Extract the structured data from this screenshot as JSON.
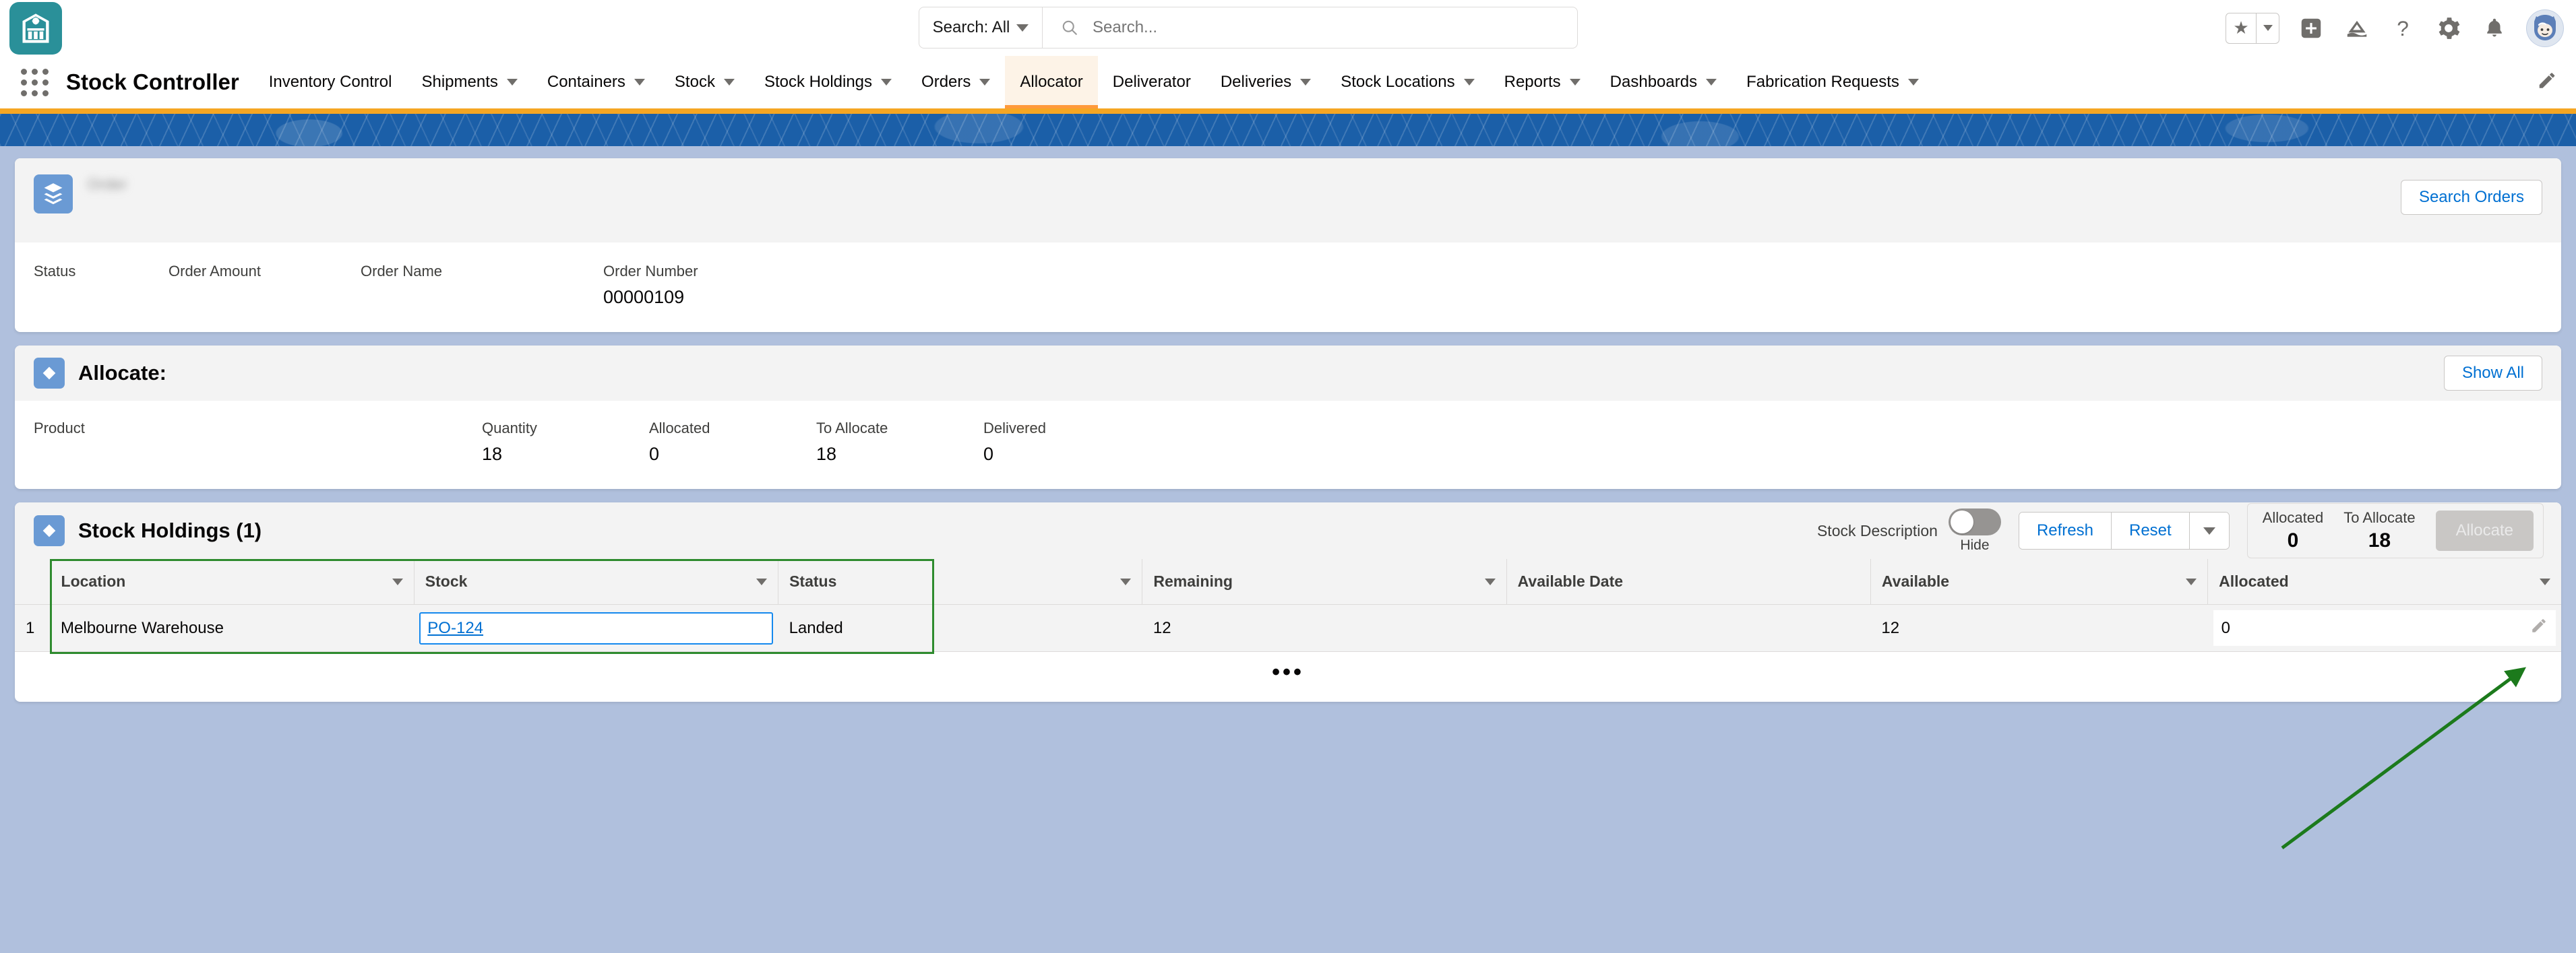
{
  "header": {
    "app_logo_icon": "warehouse-icon",
    "search": {
      "scope_label": "Search: All",
      "placeholder": "Search...",
      "value": ""
    },
    "icons": [
      "favorites-star-icon",
      "favorites-caret-icon",
      "global-add-icon",
      "app-launcher-icon",
      "help-icon",
      "setup-gear-icon",
      "notifications-bell-icon",
      "user-avatar"
    ]
  },
  "nav": {
    "app_name": "Stock Controller",
    "items": [
      {
        "label": "Inventory Control",
        "has_menu": false,
        "active": false
      },
      {
        "label": "Shipments",
        "has_menu": true,
        "active": false
      },
      {
        "label": "Containers",
        "has_menu": true,
        "active": false
      },
      {
        "label": "Stock",
        "has_menu": true,
        "active": false
      },
      {
        "label": "Stock Holdings",
        "has_menu": true,
        "active": false
      },
      {
        "label": "Orders",
        "has_menu": true,
        "active": false
      },
      {
        "label": "Allocator",
        "has_menu": false,
        "active": true
      },
      {
        "label": "Deliverator",
        "has_menu": false,
        "active": false
      },
      {
        "label": "Deliveries",
        "has_menu": true,
        "active": false
      },
      {
        "label": "Stock Locations",
        "has_menu": true,
        "active": false
      },
      {
        "label": "Reports",
        "has_menu": true,
        "active": false
      },
      {
        "label": "Dashboards",
        "has_menu": true,
        "active": false
      },
      {
        "label": "Fabrication Requests",
        "has_menu": true,
        "active": false
      }
    ],
    "edit_icon": "pencil-icon"
  },
  "order_card": {
    "icon": "order-icon",
    "eyebrow": "Order",
    "title": "",
    "search_orders_label": "Search Orders",
    "fields": [
      {
        "label": "Status",
        "value": "",
        "blurred": true
      },
      {
        "label": "Order Amount",
        "value": "",
        "blurred": true
      },
      {
        "label": "Order Name",
        "value": "",
        "blurred": true
      },
      {
        "label": "Order Number",
        "value": "00000109",
        "blurred": false
      }
    ]
  },
  "allocate_card": {
    "icon": "allocate-icon",
    "title_prefix": "Allocate:",
    "title_value": "",
    "show_all_label": "Show All",
    "columns": [
      {
        "label": "Product",
        "value": "",
        "blurred": true
      },
      {
        "label": "Quantity",
        "value": "18",
        "blurred": false
      },
      {
        "label": "Allocated",
        "value": "0",
        "blurred": false
      },
      {
        "label": "To Allocate",
        "value": "18",
        "blurred": false
      },
      {
        "label": "Delivered",
        "value": "0",
        "blurred": false
      }
    ]
  },
  "stock_holdings": {
    "icon": "stock-holdings-icon",
    "title": "Stock Holdings (1)",
    "toolbar": {
      "toggle_label": "Stock Description",
      "toggle_sub_label": "Hide",
      "toggle_on": false,
      "refresh_label": "Refresh",
      "reset_label": "Reset",
      "dropdown_icon": "chevron-down-icon",
      "summary": [
        {
          "label": "Allocated",
          "value": "0"
        },
        {
          "label": "To Allocate",
          "value": "18"
        }
      ],
      "allocate_button_label": "Allocate",
      "allocate_button_disabled": true
    },
    "table": {
      "columns": [
        "Location",
        "Stock",
        "Status",
        "Remaining",
        "Available Date",
        "Available",
        "Allocated"
      ],
      "rows": [
        {
          "index": "1",
          "location": "Melbourne Warehouse",
          "stock": "PO-124",
          "status": "Landed",
          "remaining": "12",
          "available_date": "",
          "available": "12",
          "allocated": "0",
          "allocated_edit_icon": "pencil-icon"
        }
      ],
      "more_label": "•••"
    }
  },
  "annotation": {
    "arrow_color": "#1c7a1c",
    "points_to": "allocated-cell-edit-pencil-icon"
  },
  "colors": {
    "brand_teal": "#2a9099",
    "banner_blue": "#1b5fa8",
    "accent_orange": "#f5a623",
    "link_blue": "#0070d2",
    "page_bg": "#b0c0dd",
    "focus_blue": "#1589ee",
    "highlight_green": "#2e8b2e"
  }
}
